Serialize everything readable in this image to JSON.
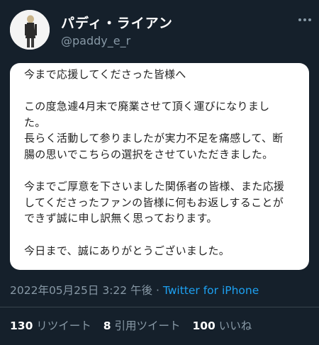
{
  "header": {
    "display_name": "パディ・ライアン",
    "handle": "@paddy_e_r"
  },
  "tweet": {
    "lines": [
      "今まで応援してくださった皆様へ",
      "",
      "この度急遽4月末で廃業させて頂く運びになりまし",
      "た。",
      "長らく活動して参りましたが実力不足を痛感して、断",
      "腸の思いでこちらの選択をさせていただきました。",
      "",
      "今までご厚意を下さいました関係者の皆様、また応援",
      "してくださったファンの皆様に何もお返しすることが",
      "できず誠に申し訳無く思っております。",
      "",
      "今日まで、誠にありがとうございました。"
    ]
  },
  "meta": {
    "timestamp": "2022年05月25日 3:22 午後",
    "separator": " · ",
    "source": "Twitter for iPhone"
  },
  "stats": {
    "retweets_count": "130",
    "retweets_label": "リツイート",
    "quotes_count": "8",
    "quotes_label": "引用ツイート",
    "likes_count": "100",
    "likes_label": "いいね"
  },
  "icons": {
    "more": "more-dots-icon",
    "avatar": "avatar"
  },
  "colors": {
    "background": "#15202b",
    "secondary_text": "#8899a6",
    "link": "#1da1f2"
  }
}
